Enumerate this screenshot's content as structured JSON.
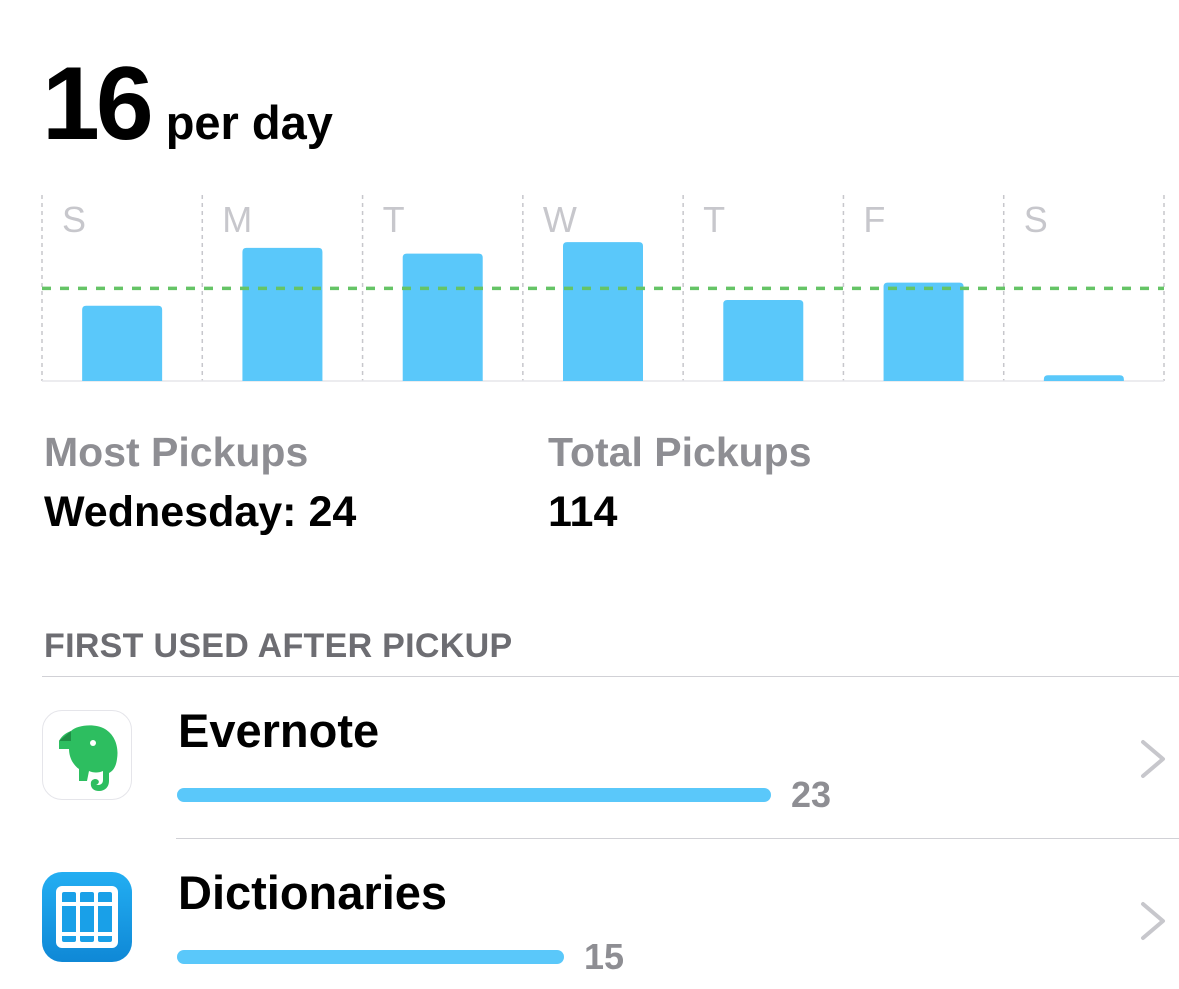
{
  "headline": {
    "value": "16",
    "unit": "per day"
  },
  "chart_data": {
    "type": "bar",
    "categories": [
      "S",
      "M",
      "T",
      "W",
      "T",
      "F",
      "S"
    ],
    "values": [
      13,
      23,
      22,
      24,
      14,
      17,
      1
    ],
    "average": 16,
    "ylim": [
      0,
      33
    ],
    "colors": {
      "bar": "#5ac8fa",
      "average_line": "#65c466",
      "grid": "#c7c7cc",
      "tick_label": "#c7c7cc"
    }
  },
  "stats": {
    "most_pickups": {
      "label": "Most Pickups",
      "value": "Wednesday: 24"
    },
    "total_pickups": {
      "label": "Total Pickups",
      "value": "114"
    }
  },
  "first_used": {
    "header": "FIRST USED AFTER PICKUP",
    "max": 23,
    "apps": [
      {
        "name": "Evernote",
        "count": "23",
        "value": 23,
        "icon": "evernote-elephant-icon"
      },
      {
        "name": "Dictionaries",
        "count": "15",
        "value": 15,
        "icon": "dictionaries-books-icon"
      }
    ]
  },
  "colors": {
    "accent": "#5ac8fa",
    "secondary_text": "#8e8e93",
    "evernote_green": "#2dbe60",
    "chevron": "#c7c7cc"
  }
}
